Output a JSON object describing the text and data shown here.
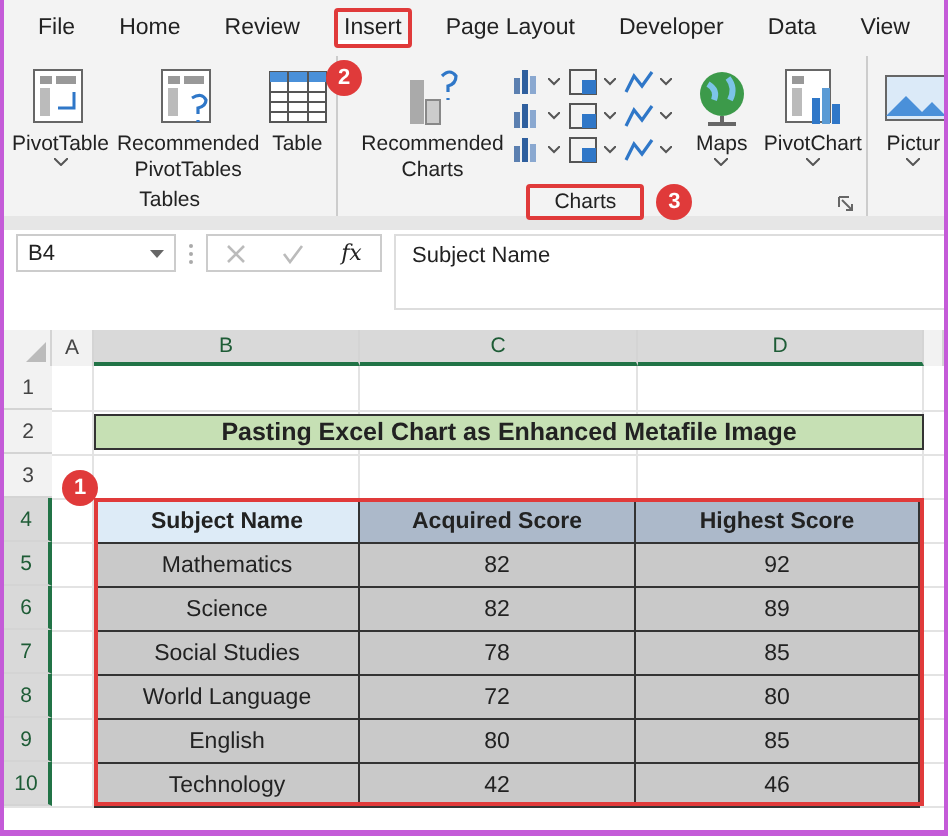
{
  "menu_tabs": [
    {
      "label": "File",
      "selected": false
    },
    {
      "label": "Home",
      "selected": false
    },
    {
      "label": "Review",
      "selected": false
    },
    {
      "label": "Insert",
      "selected": true,
      "callout": "2"
    },
    {
      "label": "Page Layout",
      "selected": false
    },
    {
      "label": "Developer",
      "selected": false
    },
    {
      "label": "Data",
      "selected": false
    },
    {
      "label": "View",
      "selected": false
    }
  ],
  "ribbon": {
    "groups": [
      {
        "label": "Tables",
        "buttons": [
          {
            "kind": "pivottable",
            "label": "PivotTable",
            "dropdown": true
          },
          {
            "kind": "recpivot",
            "label": "Recommended PivotTables",
            "dropdown": false
          },
          {
            "kind": "table",
            "label": "Table",
            "dropdown": false
          }
        ]
      },
      {
        "label": "Charts",
        "callout": "3",
        "launcher": true,
        "buttons": [
          {
            "kind": "recchart",
            "label": "Recommended Charts",
            "dropdown": false
          },
          {
            "kind": "gallery"
          },
          {
            "kind": "maps",
            "label": "Maps",
            "dropdown": true
          },
          {
            "kind": "pivotchart",
            "label": "PivotChart",
            "dropdown": true
          }
        ]
      },
      {
        "buttons": [
          {
            "kind": "pictures",
            "label": "Pictur",
            "dropdown": true
          }
        ]
      }
    ]
  },
  "formula_bar": {
    "name_box": "B4",
    "function_symbol": "fx",
    "formula": "Subject Name"
  },
  "sheet": {
    "columns": [
      {
        "label": "A",
        "selected": false
      },
      {
        "label": "B",
        "selected": true
      },
      {
        "label": "C",
        "selected": true
      },
      {
        "label": "D",
        "selected": true
      }
    ],
    "rows": [
      {
        "label": "1",
        "selected": false
      },
      {
        "label": "2",
        "selected": false
      },
      {
        "label": "3",
        "selected": false
      },
      {
        "label": "4",
        "selected": true
      },
      {
        "label": "5",
        "selected": true
      },
      {
        "label": "6",
        "selected": true
      },
      {
        "label": "7",
        "selected": true
      },
      {
        "label": "8",
        "selected": true
      },
      {
        "label": "9",
        "selected": true
      },
      {
        "label": "10",
        "selected": true
      }
    ],
    "title": "Pasting Excel Chart as Enhanced Metafile Image",
    "table": {
      "callout": "1",
      "header": [
        {
          "text": "Subject Name",
          "active": true
        },
        {
          "text": "Acquired Score",
          "active": false
        },
        {
          "text": "Highest Score",
          "active": false
        }
      ],
      "rows": [
        [
          "Mathematics",
          "82",
          "92"
        ],
        [
          "Science",
          "82",
          "89"
        ],
        [
          "Social Studies",
          "78",
          "85"
        ],
        [
          "World Language",
          "72",
          "80"
        ],
        [
          "English",
          "80",
          "85"
        ],
        [
          "Technology",
          "42",
          "46"
        ]
      ]
    }
  }
}
